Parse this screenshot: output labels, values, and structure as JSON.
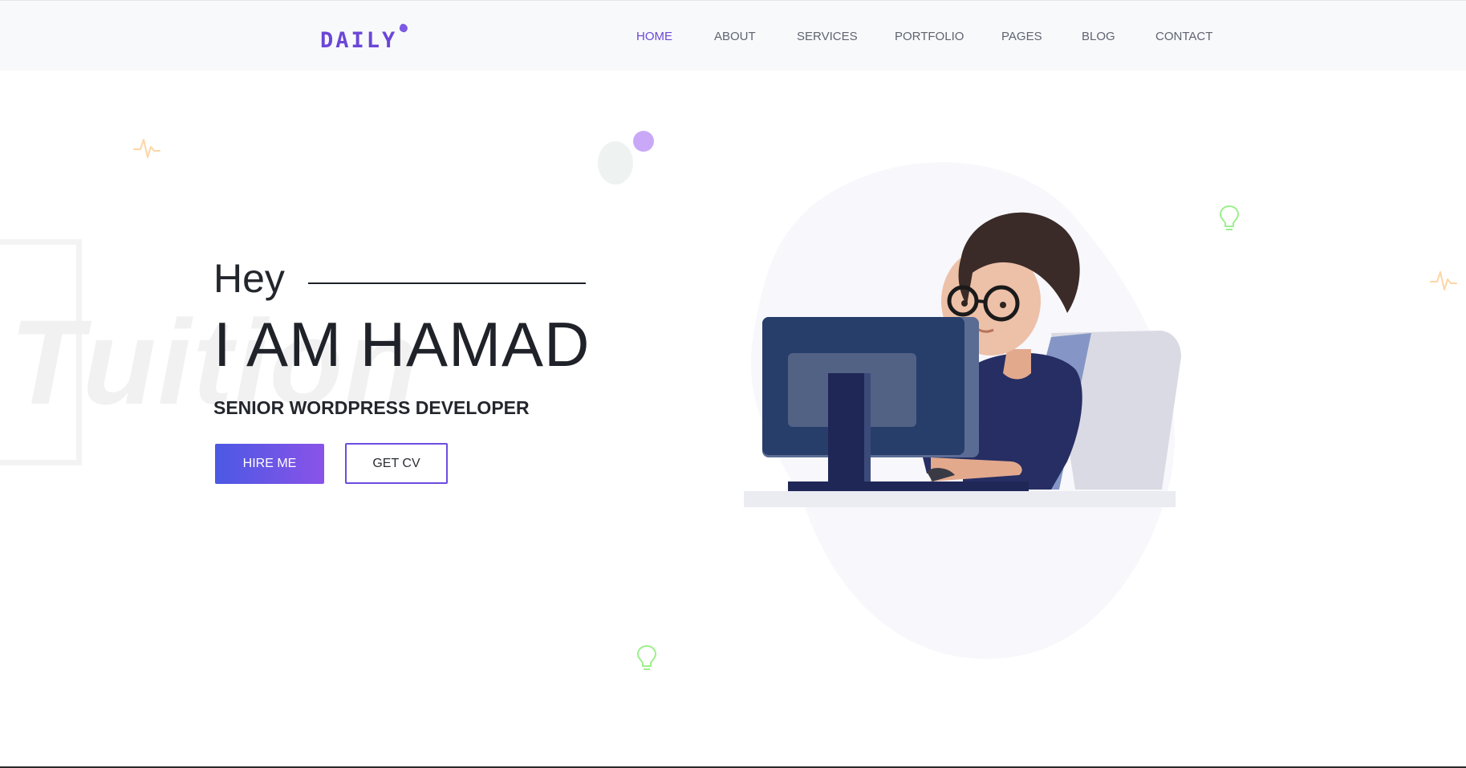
{
  "brand": {
    "logo_text": "DAILY",
    "accent_color": "#6a4ad8"
  },
  "nav": {
    "items": [
      {
        "label": "HOME",
        "active": true
      },
      {
        "label": "ABOUT",
        "active": false
      },
      {
        "label": "SERVICES",
        "active": false
      },
      {
        "label": "PORTFOLIO",
        "active": false
      },
      {
        "label": "PAGES",
        "active": false
      },
      {
        "label": "BLOG",
        "active": false
      },
      {
        "label": "CONTACT",
        "active": false
      }
    ]
  },
  "hero": {
    "greeting": "Hey",
    "name": "I AM HAMAD",
    "role": "SENIOR WORDPRESS DEVELOPER",
    "watermark": "Tuition",
    "hire_button": "HIRE ME",
    "cv_button": "GET CV",
    "button_gradient": [
      "#4b59e4",
      "#8a53e8"
    ]
  },
  "illustration": {
    "subject": "developer-at-computer-illustration",
    "blob_color": "#f7f7fc"
  },
  "decorations": {
    "pulse_color": "#fdd6a6",
    "bulb_color": "#9df08c",
    "dot_color": "#c9a9f7",
    "egg_color": "#eef3f2"
  }
}
